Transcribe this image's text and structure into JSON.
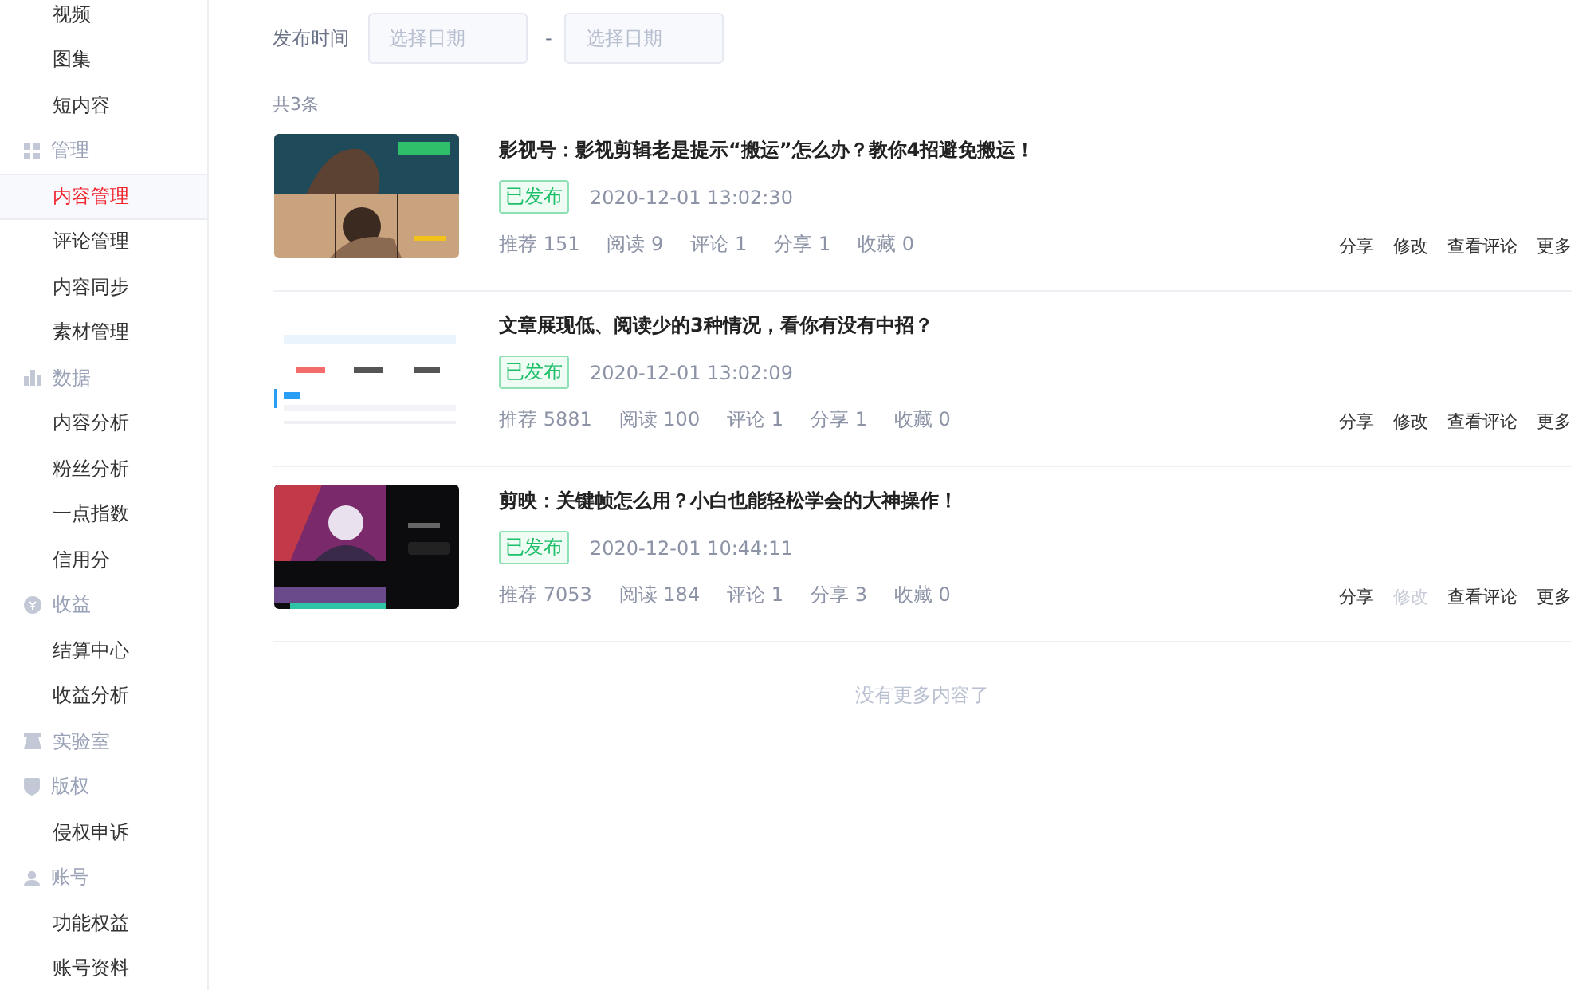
{
  "sidebar": {
    "groups": [
      {
        "items": [
          {
            "label": "视频",
            "selected": false
          },
          {
            "label": "图集",
            "selected": false
          },
          {
            "label": "短内容",
            "selected": false
          }
        ]
      },
      {
        "header": "管理",
        "items": [
          {
            "label": "内容管理",
            "selected": true
          },
          {
            "label": "评论管理",
            "selected": false
          },
          {
            "label": "内容同步",
            "selected": false
          },
          {
            "label": "素材管理",
            "selected": false
          }
        ]
      },
      {
        "header": "数据",
        "items": [
          {
            "label": "内容分析",
            "selected": false
          },
          {
            "label": "粉丝分析",
            "selected": false
          },
          {
            "label": "一点指数",
            "selected": false
          },
          {
            "label": "信用分",
            "selected": false
          }
        ]
      },
      {
        "header": "收益",
        "items": [
          {
            "label": "结算中心",
            "selected": false
          },
          {
            "label": "收益分析",
            "selected": false
          }
        ]
      },
      {
        "header": "实验室"
      },
      {
        "header": "版权",
        "items": [
          {
            "label": "侵权申诉",
            "selected": false
          }
        ]
      },
      {
        "header": "账号",
        "items": [
          {
            "label": "功能权益",
            "selected": false
          },
          {
            "label": "账号资料",
            "selected": false
          }
        ]
      }
    ]
  },
  "filter": {
    "label": "发布时间",
    "start": {
      "placeholder": "选择日期"
    },
    "separator": "-",
    "end": {
      "placeholder": "选择日期"
    }
  },
  "count": "共3条",
  "articles": [
    {
      "title": "影视号：影视剪辑老是提示“搬运”怎么办？教你4招避免搬运！",
      "status": "已发布",
      "time": "2020-12-01 13:02:30",
      "thumb": {
        "kind": "picture"
      },
      "stats": [
        "推荐 151",
        "阅读 9",
        "评论 1",
        "分享 1",
        "收藏 0"
      ],
      "actions": [
        {
          "label": "分享",
          "disabled": false
        },
        {
          "label": "修改",
          "disabled": false
        },
        {
          "label": "查看评论",
          "disabled": false
        },
        {
          "label": "更多",
          "disabled": false
        }
      ]
    },
    {
      "title": "文章展现低、阅读少的3种情况，看你有没有中招？",
      "status": "已发布",
      "time": "2020-12-01 13:02:09",
      "thumb": {
        "kind": "picture"
      },
      "stats": [
        "推荐 5881",
        "阅读 100",
        "评论 1",
        "分享 1",
        "收藏 0"
      ],
      "actions": [
        {
          "label": "分享",
          "disabled": false
        },
        {
          "label": "修改",
          "disabled": false
        },
        {
          "label": "查看评论",
          "disabled": false
        },
        {
          "label": "更多",
          "disabled": false
        }
      ]
    },
    {
      "title": "剪映：关键帧怎么用？小白也能轻松学会的大神操作！",
      "status": "已发布",
      "time": "2020-12-01 10:44:11",
      "thumb": {
        "kind": "picture"
      },
      "stats": [
        "推荐 7053",
        "阅读 184",
        "评论 1",
        "分享 3",
        "收藏 0"
      ],
      "actions": [
        {
          "label": "分享",
          "disabled": false
        },
        {
          "label": "修改",
          "disabled": true
        },
        {
          "label": "查看评论",
          "disabled": false
        },
        {
          "label": "更多",
          "disabled": false
        }
      ]
    }
  ],
  "footer": "没有更多内容了"
}
